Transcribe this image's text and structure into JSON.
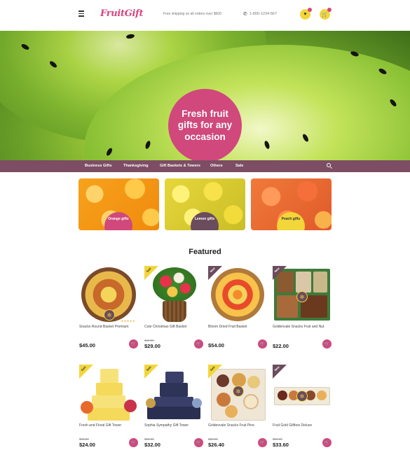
{
  "header": {
    "logo": "FruitGift",
    "shipping": "Free shipping on all orders over $600",
    "phone": "1-800-1234-567"
  },
  "hero": {
    "headline": "Fresh fruit gifts for any occasion"
  },
  "nav": {
    "items": [
      "Business Gifts",
      "Thanksgiving",
      "Gift Baskets & Towers",
      "Others",
      "Sale"
    ]
  },
  "categories": [
    {
      "label": "Orange gifts"
    },
    {
      "label": "Lemon gifts"
    },
    {
      "label": "Peach gifts"
    }
  ],
  "featured_title": "Featured",
  "products": [
    {
      "name": "Snacks Round Basket Premium",
      "old_price": "",
      "price": "$45.00",
      "ribbon": "",
      "stars": "★★★★★"
    },
    {
      "name": "Cute Christmas Gift Basket",
      "old_price": "$46.00",
      "price": "$29.00",
      "ribbon": "Sale",
      "stars": ""
    },
    {
      "name": "Bloom Dried Fruit Basket",
      "old_price": "",
      "price": "$54.00",
      "ribbon": "New",
      "stars": ""
    },
    {
      "name": "Goldenvale Snacks Fruit and Nut",
      "old_price": "",
      "price": "$22.00",
      "ribbon": "New",
      "stars": ""
    },
    {
      "name": "Fresh and Floral Gift Tower",
      "old_price": "$26.00",
      "price": "$24.00",
      "ribbon": "Sale",
      "stars": ""
    },
    {
      "name": "Sophia Sympathy Gift Tower",
      "old_price": "$36.00",
      "price": "$32.00",
      "ribbon": "Sale",
      "stars": ""
    },
    {
      "name": "Goldenvale Snacks Fruit Pine",
      "old_price": "$29.00",
      "price": "$26.40",
      "ribbon": "Sale",
      "stars": ""
    },
    {
      "name": "Fruit Gold Giftbox Deluxe",
      "old_price": "$36.00",
      "price": "$33.60",
      "ribbon": "New",
      "stars": ""
    }
  ],
  "colors": {
    "accent": "#d0487c",
    "nav": "#7d4d64",
    "yellow": "#f2d63a"
  }
}
